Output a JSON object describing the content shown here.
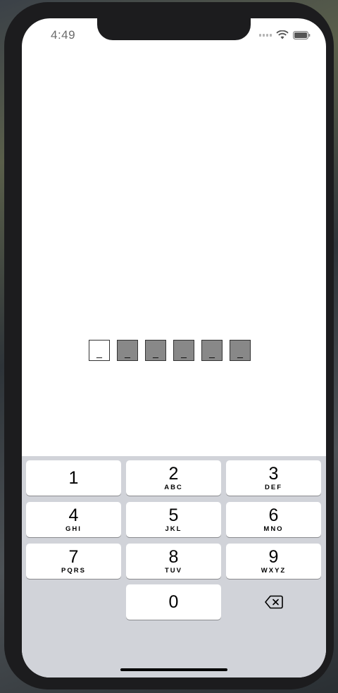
{
  "status_bar": {
    "time": "4:49",
    "signal_icon": "signal-icon",
    "wifi_icon": "wifi-icon",
    "battery_icon": "battery-icon"
  },
  "code_entry": {
    "boxes": [
      {
        "char": "_",
        "state": "active"
      },
      {
        "char": "_",
        "state": "empty"
      },
      {
        "char": "_",
        "state": "empty"
      },
      {
        "char": "_",
        "state": "empty"
      },
      {
        "char": "_",
        "state": "empty"
      },
      {
        "char": "_",
        "state": "empty"
      }
    ]
  },
  "keypad": {
    "keys": [
      {
        "number": "1",
        "letters": ""
      },
      {
        "number": "2",
        "letters": "ABC"
      },
      {
        "number": "3",
        "letters": "DEF"
      },
      {
        "number": "4",
        "letters": "GHI"
      },
      {
        "number": "5",
        "letters": "JKL"
      },
      {
        "number": "6",
        "letters": "MNO"
      },
      {
        "number": "7",
        "letters": "PQRS"
      },
      {
        "number": "8",
        "letters": "TUV"
      },
      {
        "number": "9",
        "letters": "WXYZ"
      },
      {
        "number": "0",
        "letters": ""
      }
    ],
    "delete_icon": "backspace-icon"
  },
  "colors": {
    "keyboard_bg": "#d1d3d9",
    "empty_box": "#888888",
    "active_box": "#ffffff"
  }
}
